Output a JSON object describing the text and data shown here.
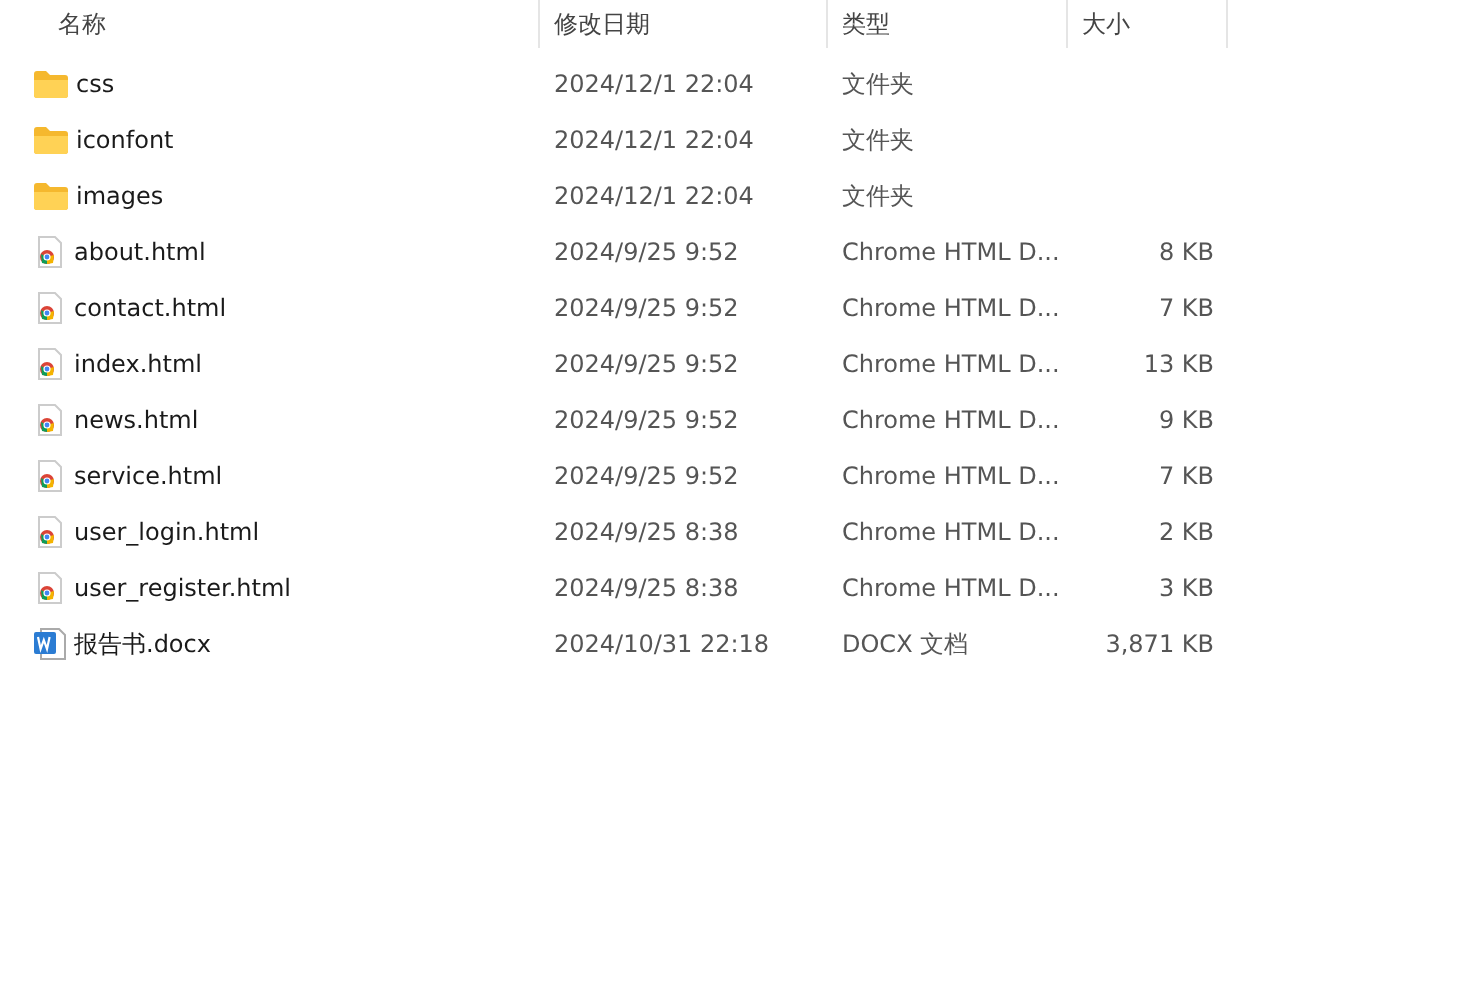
{
  "columns": [
    "名称",
    "修改日期",
    "类型",
    "大小"
  ],
  "files": [
    {
      "kind": "folder",
      "name": "css",
      "modified": "2024/12/1 22:04",
      "type": "文件夹"
    },
    {
      "kind": "folder",
      "name": "iconfont",
      "modified": "2024/12/1 22:04",
      "type": "文件夹"
    },
    {
      "kind": "folder",
      "name": "images",
      "modified": "2024/12/1 22:04",
      "type": "文件夹"
    },
    {
      "kind": "html",
      "name": "about.html",
      "modified": "2024/9/25 9:52",
      "type": "Chrome HTML D...",
      "size": "8 KB"
    },
    {
      "kind": "html",
      "name": "contact.html",
      "modified": "2024/9/25 9:52",
      "type": "Chrome HTML D...",
      "size": "7 KB"
    },
    {
      "kind": "html",
      "name": "index.html",
      "modified": "2024/9/25 9:52",
      "type": "Chrome HTML D...",
      "size": "13 KB"
    },
    {
      "kind": "html",
      "name": "news.html",
      "modified": "2024/9/25 9:52",
      "type": "Chrome HTML D...",
      "size": "9 KB"
    },
    {
      "kind": "html",
      "name": "service.html",
      "modified": "2024/9/25 9:52",
      "type": "Chrome HTML D...",
      "size": "7 KB"
    },
    {
      "kind": "html",
      "name": "user_login.html",
      "modified": "2024/9/25 8:38",
      "type": "Chrome HTML D...",
      "size": "2 KB"
    },
    {
      "kind": "html",
      "name": "user_register.html",
      "modified": "2024/9/25 8:38",
      "type": "Chrome HTML D...",
      "size": "3 KB"
    },
    {
      "kind": "docx",
      "name": "报告书.docx",
      "modified": "2024/10/31 22:18",
      "type": "DOCX 文档",
      "size": "3,871 KB"
    }
  ]
}
